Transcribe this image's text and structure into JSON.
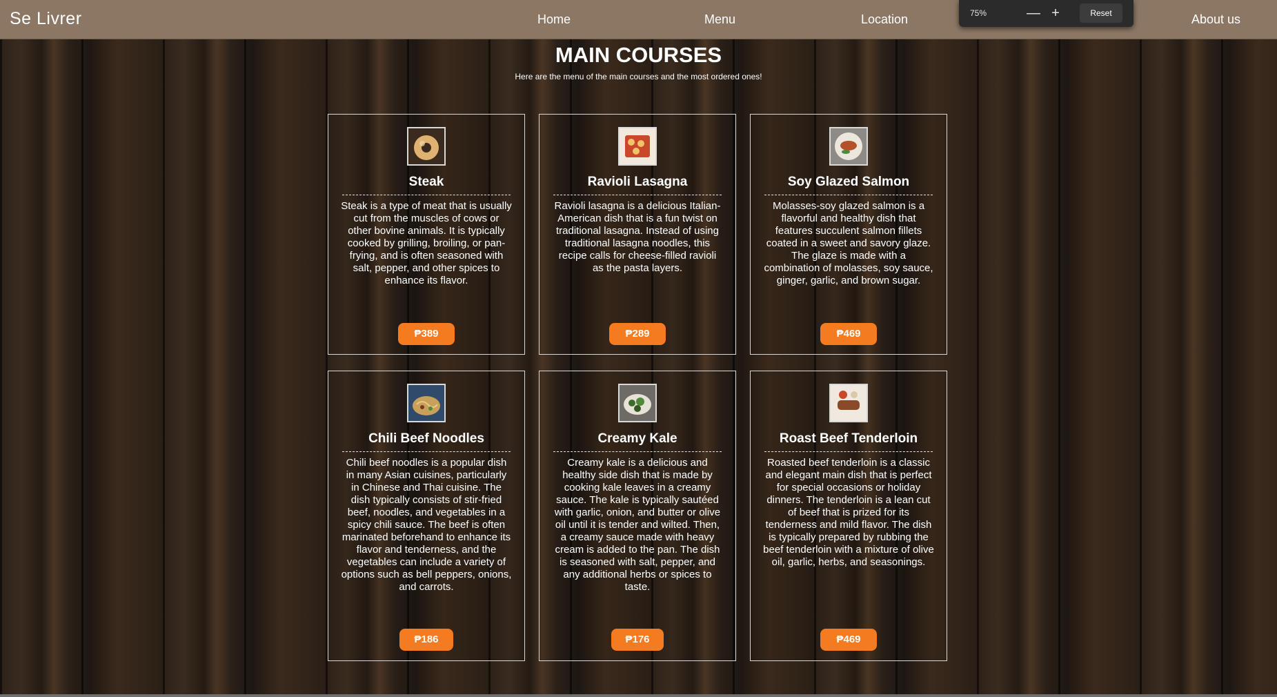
{
  "navbar": {
    "brand": "Se Livrer",
    "links": [
      "Home",
      "Menu",
      "Location",
      "About us"
    ]
  },
  "zoom": {
    "value": "75%",
    "minus": "—",
    "plus": "+",
    "reset": "Reset"
  },
  "page": {
    "title": "MAIN COURSES",
    "subtitle": "Here are the menu of the main courses and the most ordered ones!"
  },
  "cards": [
    {
      "title": "Steak",
      "description": "Steak is a type of meat that is usually cut from the muscles of cows or other bovine animals. It is typically cooked by grilling, broiling, or pan-frying, and is often seasoned with salt, pepper, and other spices to enhance its flavor.",
      "price": "₱389",
      "image": "food-photo-steak"
    },
    {
      "title": "Ravioli Lasagna",
      "description": "Ravioli lasagna is a delicious Italian-American dish that is a fun twist on traditional lasagna. Instead of using traditional lasagna noodles, this recipe calls for cheese-filled ravioli as the pasta layers.",
      "price": "₱289",
      "image": "food-photo-lasagna"
    },
    {
      "title": "Soy Glazed Salmon",
      "description": "Molasses-soy glazed salmon is a flavorful and healthy dish that features succulent salmon fillets coated in a sweet and savory glaze. The glaze is made with a combination of molasses, soy sauce, ginger, garlic, and brown sugar.",
      "price": "₱469",
      "image": "food-photo-salmon"
    },
    {
      "title": "Chili Beef Noodles",
      "description": "Chili beef noodles is a popular dish in many Asian cuisines, particularly in Chinese and Thai cuisine. The dish typically consists of stir-fried beef, noodles, and vegetables in a spicy chili sauce. The beef is often marinated beforehand to enhance its flavor and tenderness, and the vegetables can include a variety of options such as bell peppers, onions, and carrots.",
      "price": "₱186",
      "image": "food-photo-noodles"
    },
    {
      "title": "Creamy Kale",
      "description": "Creamy kale is a delicious and healthy side dish that is made by cooking kale leaves in a creamy sauce. The kale is typically sautéed with garlic, onion, and butter or olive oil until it is tender and wilted. Then, a creamy sauce made with heavy cream is added to the pan. The dish is seasoned with salt, pepper, and any additional herbs or spices to taste.",
      "price": "₱176",
      "image": "food-photo-kale"
    },
    {
      "title": "Roast Beef Tenderloin",
      "description": "Roasted beef tenderloin is a classic and elegant main dish that is perfect for special occasions or holiday dinners. The tenderloin is a lean cut of beef that is prized for its tenderness and mild flavor. The dish is typically prepared by rubbing the beef tenderloin with a mixture of olive oil, garlic, herbs, and seasonings.",
      "price": "₱469",
      "image": "food-photo-tenderloin"
    }
  ],
  "colors": {
    "navbar": "#8c7764",
    "price_button": "#f47b20"
  }
}
